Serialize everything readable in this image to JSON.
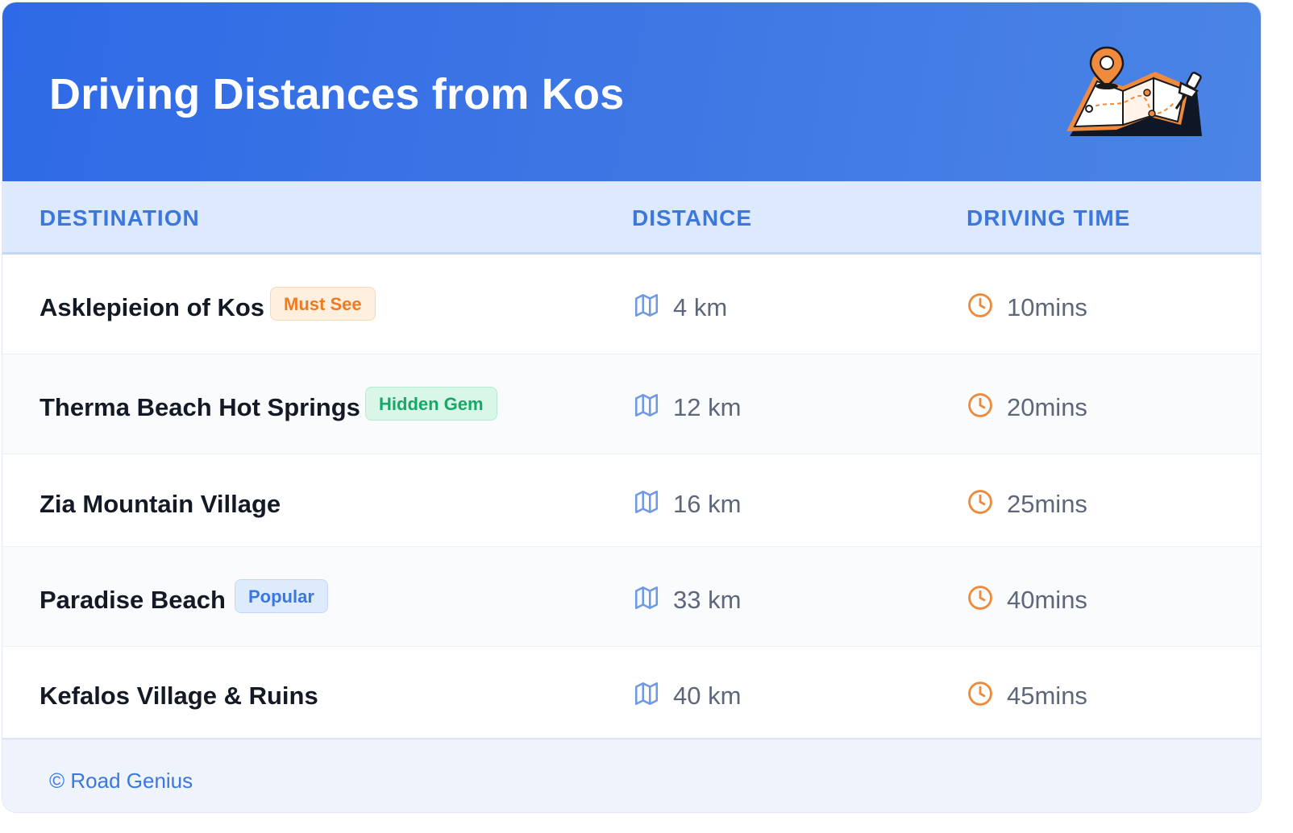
{
  "header": {
    "title": "Driving Distances from Kos",
    "illustration_icon": "map-with-pins-icon"
  },
  "table": {
    "columns": [
      "DESTINATION",
      "DISTANCE",
      "DRIVING TIME"
    ],
    "rows": [
      {
        "destination": "Asklepieion of Kos",
        "badge": "Must See",
        "badge_color": "#ef7a1f",
        "distance": "4 km",
        "time": "10mins"
      },
      {
        "destination": "Therma Beach Hot Springs",
        "badge": "Hidden Gem",
        "badge_color": "#16a866",
        "distance": "12 km",
        "time": "20mins"
      },
      {
        "destination": "Zia Mountain Village",
        "badge": "",
        "distance": "16 km",
        "time": "25mins"
      },
      {
        "destination": "Paradise Beach",
        "badge": "Popular",
        "badge_color": "#3c77dd",
        "distance": "33 km",
        "time": "40mins"
      },
      {
        "destination": "Kefalos Village & Ruins",
        "badge": "",
        "distance": "40 km",
        "time": "45mins"
      }
    ],
    "distance_icon": "map-icon",
    "time_icon": "clock-icon"
  },
  "footer": {
    "credit": "© Road Genius"
  },
  "colors": {
    "header_gradient_start": "#2f6ae6",
    "header_gradient_end": "#4b84e6",
    "accent_blue": "#3c77dd",
    "clock_orange": "#ee8a3c"
  }
}
